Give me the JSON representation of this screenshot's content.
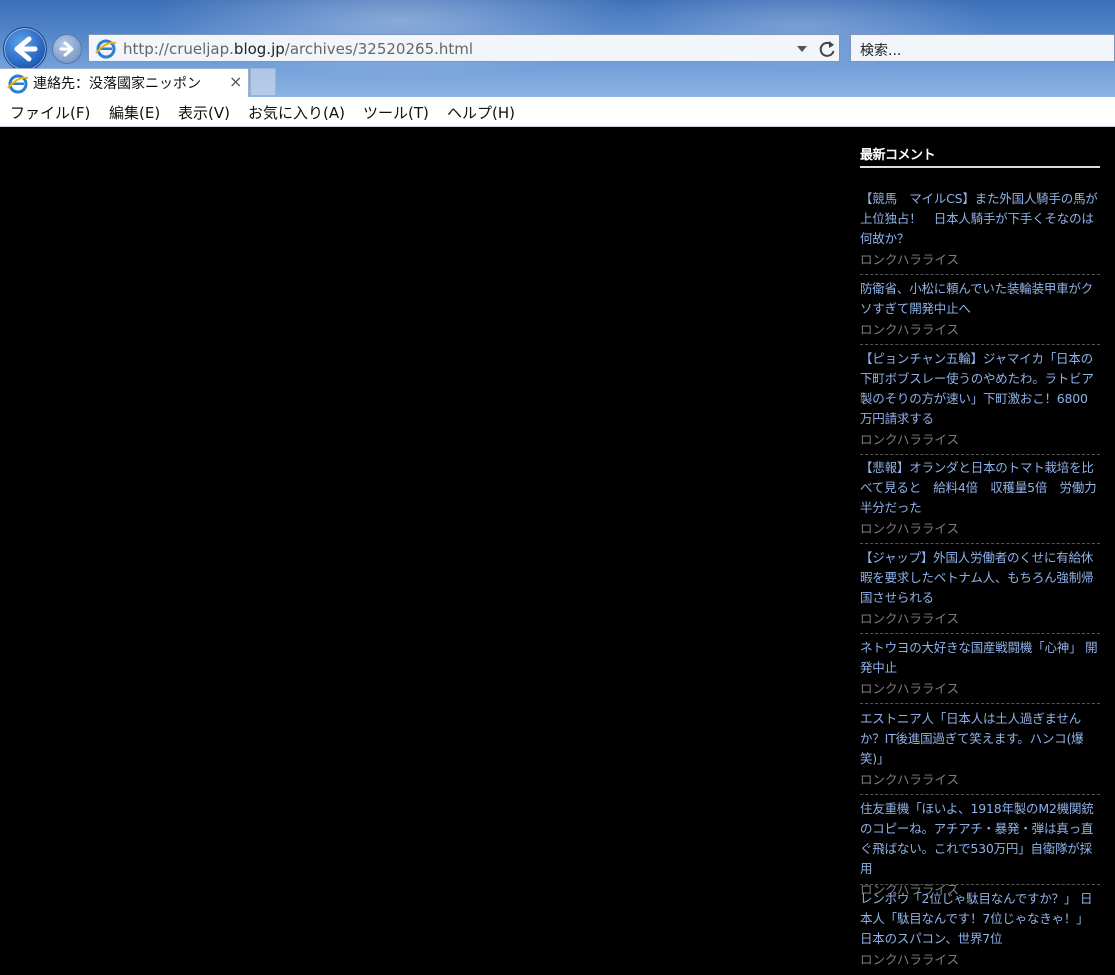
{
  "browser": {
    "url_prefix": "http://crueljap.",
    "url_host": "blog.jp",
    "url_suffix": "/archives/32520265.html",
    "search_placeholder": "検索...",
    "tab_title": "連絡先：没落國家ニッポン",
    "tab_close": "×"
  },
  "menu": [
    "ファイル(F)",
    "編集(E)",
    "表示(V)",
    "お気に入り(A)",
    "ツール(T)",
    "ヘルプ(H)"
  ],
  "sidebar": {
    "title": "最新コメント",
    "link_color": "#8fb1e8",
    "comments": [
      {
        "title": "【競馬　マイルCS】また外国人騎手の馬が上位独占！　日本人騎手が下手くそなのは何故か？",
        "author": "ロンクハラライス"
      },
      {
        "title": "防衛省、小松に頼んでいた装輪装甲車がクソすぎて開発中止へ",
        "author": "ロンクハラライス"
      },
      {
        "title": "【ピョンチャン五輪】ジャマイカ「日本の下町ボブスレー使うのやめたわ。ラトビア製のそりの方が速い」下町激おこ！6800万円請求する",
        "author": "ロンクハラライス"
      },
      {
        "title": "【悲報】オランダと日本のトマト栽培を比べて見ると　給料4倍　収穫量5倍　労働力半分だった",
        "author": "ロンクハラライス"
      },
      {
        "title": "【ジャップ】外国人労働者のくせに有給休暇を要求したベトナム人、もちろん強制帰国させられる",
        "author": "ロンクハラライス"
      },
      {
        "title": "ネトウヨの大好きな国産戦闘機「心神」 開発中止",
        "author": "ロンクハラライス"
      },
      {
        "title": "エストニア人「日本人は土人過ぎませんか？IT後進国過ぎて笑えます。ハンコ(爆笑)」",
        "author": "ロンクハラライス"
      },
      {
        "title": "住友重機「ほいよ、1918年製のM2機関銃のコピーね。アチアチ・暴発・弾は真っ直ぐ飛ばない。これで530万円」自衛隊が採用",
        "author": "ロンクハラライス"
      },
      {
        "title": "レンポウ「2位じゃ駄目なんですか？」 日本人「駄目なんです！7位じゃなきゃ！」 日本のスパコン、世界7位",
        "author": "ロンクハラライス"
      }
    ]
  }
}
